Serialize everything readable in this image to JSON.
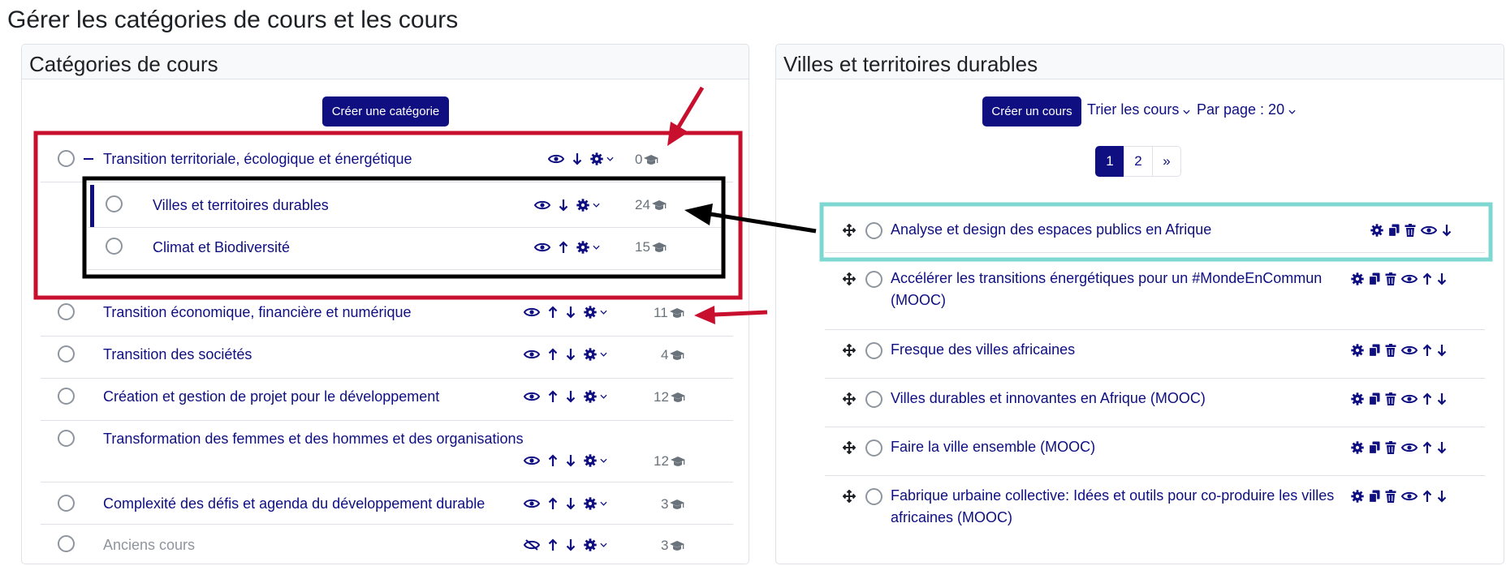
{
  "page_title": "Gérer les catégories de cours et les cours",
  "left": {
    "title": "Catégories de cours",
    "create_button": "Créer une catégorie",
    "categories": [
      {
        "name": "Transition territoriale, écologique et énergétique",
        "count": "0"
      },
      {
        "name": "Villes et territoires durables",
        "count": "24"
      },
      {
        "name": "Climat et Biodiversité",
        "count": "15"
      },
      {
        "name": "Transition économique, financière et numérique",
        "count": "11"
      },
      {
        "name": "Transition des sociétés",
        "count": "4"
      },
      {
        "name": "Création et gestion de projet pour le développement",
        "count": "12"
      },
      {
        "name": "Transformation des femmes et des hommes et des organisations",
        "count": "12"
      },
      {
        "name": "Complexité des défis et agenda du développement durable",
        "count": "3"
      },
      {
        "name": "Anciens cours",
        "count": "3"
      }
    ]
  },
  "right": {
    "title": "Villes et territoires durables",
    "create_button": "Créer un cours",
    "sort_label": "Trier les cours",
    "per_page_label": "Par page : 20",
    "pagination": [
      "1",
      "2",
      "»"
    ],
    "courses": [
      {
        "line1": "Analyse et design des espaces publics en Afrique",
        "line2": ""
      },
      {
        "line1": "Accélérer les transitions énergétiques pour un #MondeEnCommun",
        "line2": "(MOOC)"
      },
      {
        "line1": "Fresque des villes africaines",
        "line2": ""
      },
      {
        "line1": "Villes durables et innovantes en Afrique (MOOC)",
        "line2": ""
      },
      {
        "line1": "Faire la ville ensemble (MOOC)",
        "line2": ""
      },
      {
        "line1": "Fabrique urbaine collective: Idées et outils pour co-produire les villes",
        "line2": "africaines (MOOC)"
      }
    ]
  },
  "colors": {
    "brand": "#0f0f82",
    "annotation_red": "#c8102e",
    "annotation_teal": "#7fd7d2",
    "annotation_black": "#000000"
  }
}
